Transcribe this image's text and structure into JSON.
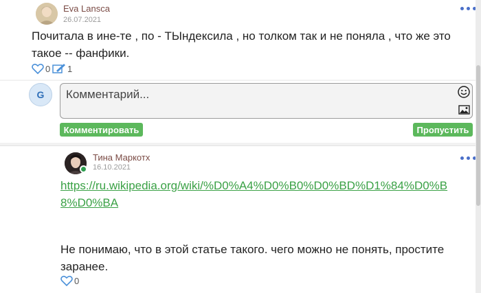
{
  "comment1": {
    "author": "Eva Lansca",
    "date": "26.07.2021",
    "text": "Почитала в ине-те , по - ТЫндексила , но толком так и не поняла , что же это такое -- фанфики.",
    "likes": "0",
    "replies": "1",
    "avatar_icon": "portrait-avatar"
  },
  "reply_form": {
    "avatar_letter": "G",
    "placeholder": "Комментарий...",
    "submit_label": "Комментировать",
    "skip_label": "Пропустить",
    "accent_color": "#5cb85c"
  },
  "comment2": {
    "author": "Тина Маркотх",
    "date": "16.10.2021",
    "link": "https://ru.wikipedia.org/wiki/%D0%A4%D0%B0%D0%BD%D1%84%D0%B8%D0%BA",
    "text": "Не понимаю, что в этой статье такого. чего можно не понять, простите заранее.",
    "likes": "0",
    "online_color": "#2e9e4f"
  }
}
